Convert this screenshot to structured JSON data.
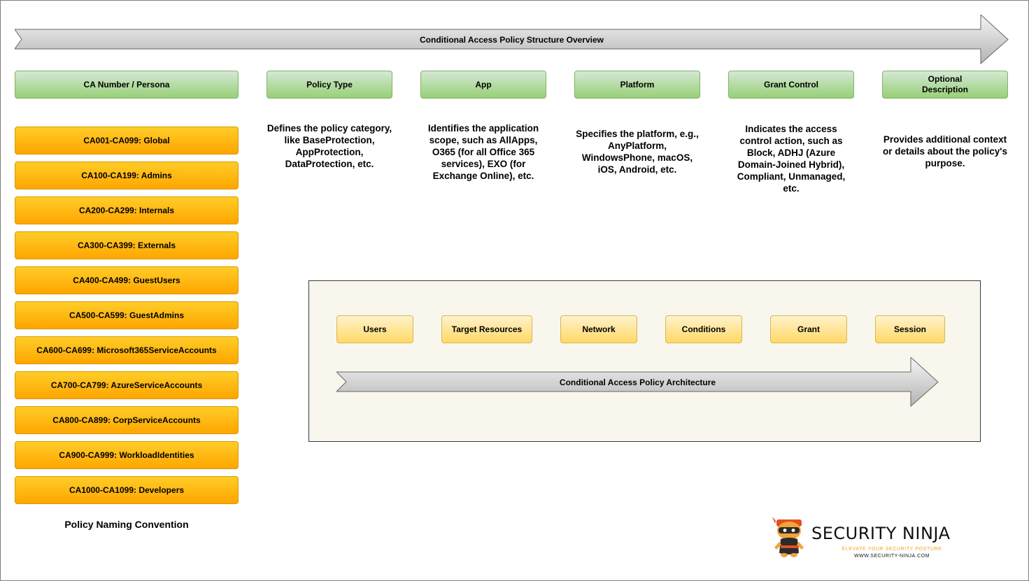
{
  "overview_arrow": {
    "label": "Conditional Access Policy Structure Overview"
  },
  "headers": [
    {
      "label": "CA Number / Persona"
    },
    {
      "label": "Policy Type"
    },
    {
      "label": "App"
    },
    {
      "label": "Platform"
    },
    {
      "label": "Grant Control"
    },
    {
      "label": "Optional Description"
    }
  ],
  "descriptions": [
    {
      "text": "Defines the policy category, like BaseProtection, AppProtection, DataProtection, etc."
    },
    {
      "text": "Identifies the application scope, such as AllApps, O365 (for all Office 365 services), EXO (for Exchange Online), etc."
    },
    {
      "text": "Specifies the platform, e.g., AnyPlatform, WindowsPhone, macOS, iOS, Android, etc."
    },
    {
      "text": "Indicates the access control action, such as Block, ADHJ (Azure Domain-Joined Hybrid), Compliant, Unmanaged, etc."
    },
    {
      "text": "Provides additional context or details about the policy's purpose."
    }
  ],
  "personas": [
    "CA001-CA099: Global",
    "CA100-CA199: Admins",
    "CA200-CA299: Internals",
    "CA300-CA399: Externals",
    "CA400-CA499: GuestUsers",
    "CA500-CA599: GuestAdmins",
    "CA600-CA699: Microsoft365ServiceAccounts",
    "CA700-CA799: AzureServiceAccounts",
    "CA800-CA899: CorpServiceAccounts",
    "CA900-CA999: WorkloadIdentities",
    "CA1000-CA1099: Developers"
  ],
  "naming_caption": "Policy Naming Convention",
  "architecture": {
    "components": [
      "Users",
      "Target Resources",
      "Network",
      "Conditions",
      "Grant",
      "Session"
    ],
    "arrow_label": "Conditional Access Policy Architecture"
  },
  "logo": {
    "brand": "SECURITY NINJA",
    "tagline": "ELEVATE YOUR SECURITY POSTURE",
    "url": "WWW.SECURITY-NINJA.COM"
  },
  "colors": {
    "green_fill": "#d5e8d4",
    "green_stroke": "#82b366",
    "orange_fill": "#ffcd28",
    "orange_stroke": "#d79b00",
    "yellow_fill": "#fff2cc",
    "yellow_stroke": "#d6b656",
    "arrow_fill": "#e6e6e6",
    "panel_fill": "#f9f7ed"
  }
}
